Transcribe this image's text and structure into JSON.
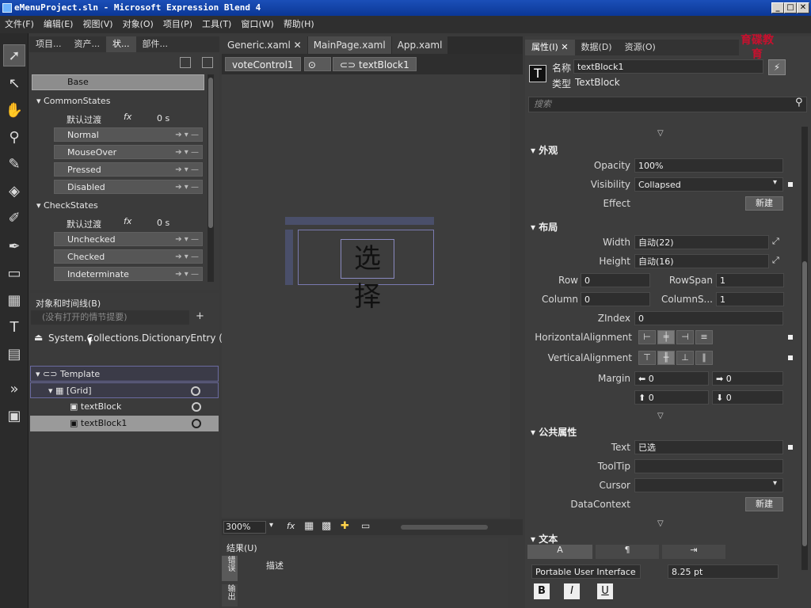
{
  "window": {
    "title": "eMenuProject.sln - Microsoft Expression Blend 4",
    "min": "_",
    "max": "□",
    "close": "✕"
  },
  "menu": [
    "文件(F)",
    "编辑(E)",
    "视图(V)",
    "对象(O)",
    "项目(P)",
    "工具(T)",
    "窗口(W)",
    "帮助(H)"
  ],
  "left_panel": {
    "tabs": [
      "项目...",
      "资产...",
      "状...",
      "部件..."
    ],
    "base": "Base",
    "groups": [
      {
        "name": "CommonStates",
        "default_transition": "默认过渡",
        "fx": "fx",
        "duration": "0 s",
        "states": [
          "Normal",
          "MouseOver",
          "Pressed",
          "Disabled"
        ]
      },
      {
        "name": "CheckStates",
        "default_transition": "默认过渡",
        "fx": "fx",
        "duration": "0 s",
        "states": [
          "Unchecked",
          "Checked",
          "Indeterminate"
        ]
      }
    ]
  },
  "objects_panel": {
    "title": "对象和时间线(B)",
    "storyboard_placeholder": "(没有打开的情节提要)",
    "scope": "System.Collections.DictionaryEntry (Vo...",
    "tree": [
      {
        "label": "Template",
        "indent": 0,
        "eye": false
      },
      {
        "label": "[Grid]",
        "indent": 1,
        "eye": true
      },
      {
        "label": "textBlock",
        "indent": 2,
        "eye": true
      },
      {
        "label": "textBlock1",
        "indent": 2,
        "eye": true
      }
    ]
  },
  "document": {
    "tabs": [
      "Generic.xaml",
      "MainPage.xaml",
      "App.xaml"
    ],
    "breadcrumb": [
      "voteControl1",
      "textBlock1"
    ],
    "canvas_text": "选择",
    "zoom": "300%",
    "fx": "fx"
  },
  "results": {
    "title": "结果(U)",
    "side_tabs": [
      "错误",
      "输出"
    ],
    "column": "描述"
  },
  "logo": {
    "text": "育碟教育"
  },
  "properties": {
    "tabs": [
      "属性(I)",
      "数据(D)",
      "资源(O)"
    ],
    "name_label": "名称",
    "name_value": "textBlock1",
    "type_label": "类型",
    "type_value": "TextBlock",
    "search_placeholder": "搜索",
    "appearance": {
      "title": "外观",
      "opacity_label": "Opacity",
      "opacity": "100%",
      "visibility_label": "Visibility",
      "visibility": "Collapsed",
      "effect_label": "Effect",
      "new_button": "新建"
    },
    "layout": {
      "title": "布局",
      "width_label": "Width",
      "width": "自动(22)",
      "height_label": "Height",
      "height": "自动(16)",
      "row_label": "Row",
      "row": "0",
      "rowspan_label": "RowSpan",
      "rowspan": "1",
      "column_label": "Column",
      "column": "0",
      "columnspan_label": "ColumnS...",
      "columnspan": "1",
      "zindex_label": "ZIndex",
      "zindex": "0",
      "halign_label": "HorizontalAlignment",
      "valign_label": "VerticalAlignment",
      "margin_label": "Margin",
      "margin": [
        "0",
        "0",
        "0",
        "0"
      ]
    },
    "common": {
      "title": "公共属性",
      "text_label": "Text",
      "text": "已选",
      "tooltip_label": "ToolTip",
      "tooltip": "",
      "cursor_label": "Cursor",
      "cursor": "",
      "datacontext_label": "DataContext",
      "new_button": "新建"
    },
    "text_section": {
      "title": "文本",
      "font": "Portable User Interface",
      "size": "8.25 pt",
      "bold": "B",
      "italic": "I",
      "underline": "U"
    }
  },
  "colors": {
    "accent": "#0b3796",
    "selection": "#5a5a8a",
    "logo": "#c8102e"
  }
}
